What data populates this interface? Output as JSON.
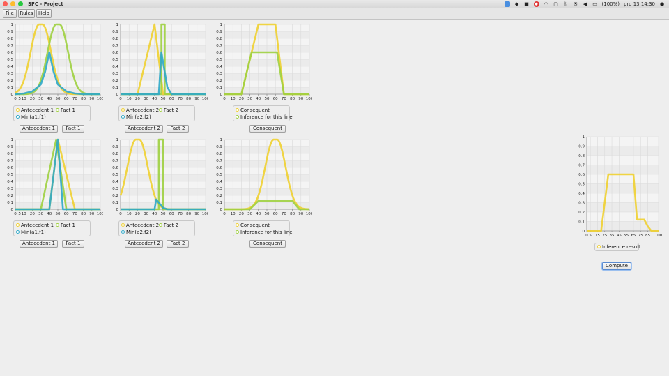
{
  "window": {
    "title": "SFC - Project",
    "controls": [
      {
        "name": "close",
        "color": "#fc5f57"
      },
      {
        "name": "minimize",
        "color": "#fdbc2e"
      },
      {
        "name": "zoom",
        "color": "#28c840"
      }
    ]
  },
  "tray": {
    "battery": "(100%)",
    "clock": "pro 13 14:30"
  },
  "menu": {
    "file": "File",
    "rules": "Rules",
    "help": "Help"
  },
  "colors": {
    "yellow": "#f0d030",
    "green": "#9fd040",
    "blue": "#2ea8c8"
  },
  "rows": [
    {
      "antecedent1": {
        "legend": [
          "Antecedent 1",
          "Fact 1",
          "Min(a1,f1)"
        ],
        "buttons": [
          "Antecedent 1",
          "Fact 1"
        ]
      },
      "antecedent2": {
        "legend": [
          "Antecedent 2",
          "Fact 2",
          "Min(a2,f2)"
        ],
        "buttons": [
          "Antecedent 2",
          "Fact 2"
        ]
      },
      "consequent": {
        "legend": [
          "Consequent",
          "Inference for this line"
        ],
        "buttons": [
          "Consequent"
        ]
      }
    },
    {
      "antecedent1": {
        "legend": [
          "Antecedent 1",
          "Fact 1",
          "Min(a1,f1)"
        ],
        "buttons": [
          "Antecedent 1",
          "Fact 1"
        ]
      },
      "antecedent2": {
        "legend": [
          "Antecedent 2",
          "Fact 2",
          "Min(a2,f2)"
        ],
        "buttons": [
          "Antecedent 2",
          "Fact 2"
        ]
      },
      "consequent": {
        "legend": [
          "Consequent",
          "Inference for this line"
        ],
        "buttons": [
          "Consequent"
        ]
      }
    }
  ],
  "result": {
    "legend": "Inference result",
    "compute": "Compute"
  },
  "chart_data": [
    {
      "type": "line",
      "id": "r1-antecedent1",
      "ylim": [
        0,
        1
      ],
      "xlim": [
        0,
        100
      ],
      "x_ticks": [
        "0",
        "5",
        "10",
        "20",
        "30",
        "40",
        "50",
        "60",
        "70",
        "80",
        "90",
        "100"
      ],
      "y_ticks": [
        "0",
        "0.1",
        "0.2",
        "0.3",
        "0.4",
        "0.5",
        "0.6",
        "0.7",
        "0.8",
        "0.9",
        "1"
      ],
      "series": [
        {
          "name": "Antecedent 1",
          "color": "yellow",
          "shape": "gaussian",
          "mean": 30,
          "sd": 10,
          "plateau": [
            28,
            32
          ]
        },
        {
          "name": "Fact 1",
          "color": "green",
          "shape": "gaussian",
          "mean": 50,
          "sd": 10,
          "plateau": [
            48,
            52
          ]
        },
        {
          "name": "Min(a1,f1)",
          "color": "blue",
          "x": [
            0,
            10,
            20,
            30,
            35,
            40,
            45,
            50,
            60,
            70,
            80,
            100
          ],
          "y": [
            0,
            0.01,
            0.04,
            0.14,
            0.32,
            0.6,
            0.32,
            0.14,
            0.04,
            0.01,
            0,
            0
          ]
        }
      ]
    },
    {
      "type": "line",
      "id": "r1-antecedent2",
      "ylim": [
        0,
        1
      ],
      "xlim": [
        0,
        100
      ],
      "x_ticks": [
        "0",
        "10",
        "20",
        "30",
        "40",
        "50",
        "60",
        "70",
        "80",
        "90",
        "100"
      ],
      "y_ticks": [
        "0",
        "0.1",
        "0.2",
        "0.3",
        "0.4",
        "0.5",
        "0.6",
        "0.7",
        "0.8",
        "0.9",
        "1"
      ],
      "series": [
        {
          "name": "Antecedent 2",
          "color": "yellow",
          "x": [
            0,
            20,
            40,
            50,
            60,
            100
          ],
          "y": [
            0,
            0,
            1,
            0,
            0,
            0
          ]
        },
        {
          "name": "Fact 2",
          "color": "green",
          "x": [
            0,
            45,
            48,
            48,
            52,
            52,
            60,
            100
          ],
          "y": [
            0,
            0,
            0,
            1,
            1,
            0,
            0,
            0
          ]
        },
        {
          "name": "Min(a2,f2)",
          "color": "blue",
          "x": [
            0,
            45,
            48,
            55,
            60,
            100
          ],
          "y": [
            0,
            0,
            0.6,
            0.1,
            0,
            0
          ]
        }
      ]
    },
    {
      "type": "line",
      "id": "r1-consequent",
      "ylim": [
        0,
        1
      ],
      "xlim": [
        0,
        100
      ],
      "x_ticks": [
        "0",
        "10",
        "20",
        "30",
        "40",
        "50",
        "60",
        "70",
        "80",
        "90",
        "100"
      ],
      "y_ticks": [
        "0",
        "0.1",
        "0.2",
        "0.3",
        "0.4",
        "0.5",
        "0.6",
        "0.7",
        "0.8",
        "0.9",
        "1"
      ],
      "series": [
        {
          "name": "Consequent",
          "color": "yellow",
          "x": [
            0,
            20,
            40,
            60,
            70,
            100
          ],
          "y": [
            0,
            0,
            1,
            1,
            0,
            0
          ]
        },
        {
          "name": "Inference for this line",
          "color": "green",
          "x": [
            0,
            20,
            32,
            62,
            70,
            100
          ],
          "y": [
            0,
            0,
            0.6,
            0.6,
            0,
            0
          ]
        }
      ]
    },
    {
      "type": "line",
      "id": "r2-antecedent1",
      "ylim": [
        0,
        1
      ],
      "xlim": [
        0,
        100
      ],
      "x_ticks": [
        "0",
        "5",
        "10",
        "20",
        "30",
        "40",
        "50",
        "60",
        "70",
        "80",
        "90",
        "100"
      ],
      "y_ticks": [
        "0",
        "0.1",
        "0.2",
        "0.3",
        "0.4",
        "0.5",
        "0.6",
        "0.7",
        "0.8",
        "0.9",
        "1"
      ],
      "series": [
        {
          "name": "Antecedent 1",
          "color": "yellow",
          "x": [
            0,
            40,
            50,
            70,
            100
          ],
          "y": [
            0,
            0,
            1,
            0,
            0
          ]
        },
        {
          "name": "Fact 1",
          "color": "green",
          "x": [
            0,
            30,
            48,
            60,
            100
          ],
          "y": [
            0,
            0,
            1,
            0,
            0
          ]
        },
        {
          "name": "Min(a1,f1)",
          "color": "blue",
          "x": [
            0,
            40,
            50,
            56,
            100
          ],
          "y": [
            0,
            0,
            1,
            0,
            0
          ]
        }
      ]
    },
    {
      "type": "line",
      "id": "r2-antecedent2",
      "ylim": [
        0,
        1
      ],
      "xlim": [
        0,
        100
      ],
      "x_ticks": [
        "0",
        "10",
        "20",
        "30",
        "40",
        "50",
        "60",
        "70",
        "80",
        "90",
        "100"
      ],
      "y_ticks": [
        "0",
        "0.1",
        "0.2",
        "0.3",
        "0.4",
        "0.5",
        "0.6",
        "0.7",
        "0.8",
        "0.9",
        "1"
      ],
      "series": [
        {
          "name": "Antecedent 2",
          "color": "yellow",
          "shape": "gaussian",
          "mean": 20,
          "sd": 10,
          "plateau": [
            18,
            22
          ]
        },
        {
          "name": "Fact 2",
          "color": "green",
          "x": [
            0,
            40,
            45,
            45,
            50,
            50,
            55,
            100
          ],
          "y": [
            0,
            0,
            0,
            1,
            1,
            0,
            0,
            0
          ]
        },
        {
          "name": "Min(a2,f2)",
          "color": "blue",
          "x": [
            0,
            40,
            42,
            50,
            55,
            100
          ],
          "y": [
            0,
            0,
            0.14,
            0.02,
            0,
            0
          ]
        }
      ]
    },
    {
      "type": "line",
      "id": "r2-consequent",
      "ylim": [
        0,
        1
      ],
      "xlim": [
        0,
        100
      ],
      "x_ticks": [
        "0",
        "10",
        "20",
        "30",
        "40",
        "50",
        "60",
        "70",
        "80",
        "90",
        "100"
      ],
      "y_ticks": [
        "0",
        "0.1",
        "0.2",
        "0.3",
        "0.4",
        "0.5",
        "0.6",
        "0.7",
        "0.8",
        "0.9",
        "1"
      ],
      "series": [
        {
          "name": "Consequent",
          "color": "yellow",
          "shape": "gaussian",
          "mean": 60,
          "sd": 10,
          "plateau": [
            58,
            62
          ]
        },
        {
          "name": "Inference for this line",
          "color": "green",
          "x": [
            0,
            30,
            40,
            80,
            88,
            100
          ],
          "y": [
            0,
            0,
            0.12,
            0.12,
            0,
            0
          ]
        }
      ]
    },
    {
      "type": "line",
      "id": "inference-result",
      "ylim": [
        0,
        1
      ],
      "xlim": [
        0,
        100
      ],
      "x_ticks": [
        "0",
        "5",
        "15",
        "25",
        "35",
        "45",
        "55",
        "65",
        "75",
        "85",
        "100"
      ],
      "y_ticks": [
        "0",
        "0.1",
        "0.2",
        "0.3",
        "0.4",
        "0.5",
        "0.6",
        "0.7",
        "0.8",
        "0.9",
        "1"
      ],
      "series": [
        {
          "name": "Inference result",
          "color": "yellow",
          "x": [
            0,
            20,
            30,
            65,
            70,
            80,
            85,
            90,
            100
          ],
          "y": [
            0,
            0,
            0.6,
            0.6,
            0.12,
            0.12,
            0.05,
            0,
            0
          ]
        }
      ]
    }
  ]
}
